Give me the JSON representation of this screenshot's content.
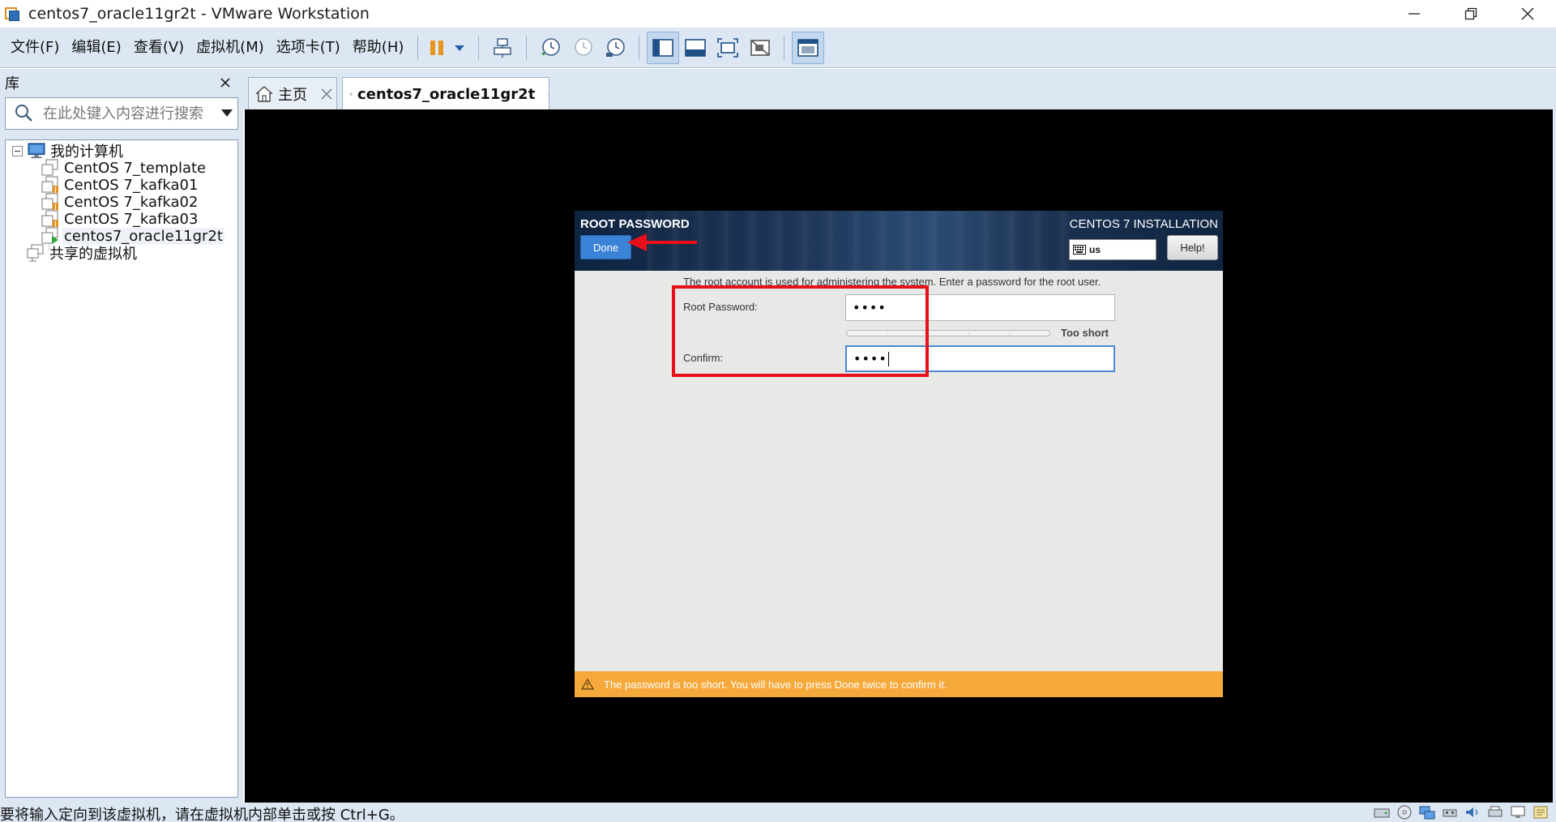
{
  "window": {
    "title": "centos7_oracle11gr2t - VMware Workstation"
  },
  "menu": {
    "items": [
      "文件(F)",
      "编辑(E)",
      "查看(V)",
      "虚拟机(M)",
      "选项卡(T)",
      "帮助(H)"
    ]
  },
  "library": {
    "title": "库",
    "search_placeholder": "在此处键入内容进行搜索",
    "tree": {
      "root": "我的计算机",
      "vms": [
        "CentOS 7_template",
        "CentOS 7_kafka01",
        "CentOS 7_kafka02",
        "CentOS 7_kafka03",
        "centos7_oracle11gr2t"
      ],
      "shared": "共享的虚拟机"
    }
  },
  "tabs": [
    {
      "label": "主页",
      "icon": "home-icon"
    },
    {
      "label": "centos7_oracle11gr2t",
      "icon": "vm-running-icon"
    }
  ],
  "installer": {
    "section_title": "ROOT PASSWORD",
    "done_label": "Done",
    "product_title": "CENTOS 7 INSTALLATION",
    "keyboard_layout": "us",
    "help_label": "Help!",
    "description": "The root account is used for administering the system.  Enter a password for the root user.",
    "root_password_label": "Root Password:",
    "root_password_value": "••••",
    "confirm_label": "Confirm:",
    "confirm_value": "••••",
    "strength_text": "Too short",
    "warning_text": "The password is too short. You will have to press Done twice to confirm it."
  },
  "status": {
    "message": "要将输入定向到该虚拟机，请在虚拟机内部单击或按 Ctrl+G。"
  },
  "colors": {
    "accent": "#3b83d6",
    "warning": "#f6a93b",
    "annotation": "#e8101a",
    "chrome": "#dce7f3"
  }
}
